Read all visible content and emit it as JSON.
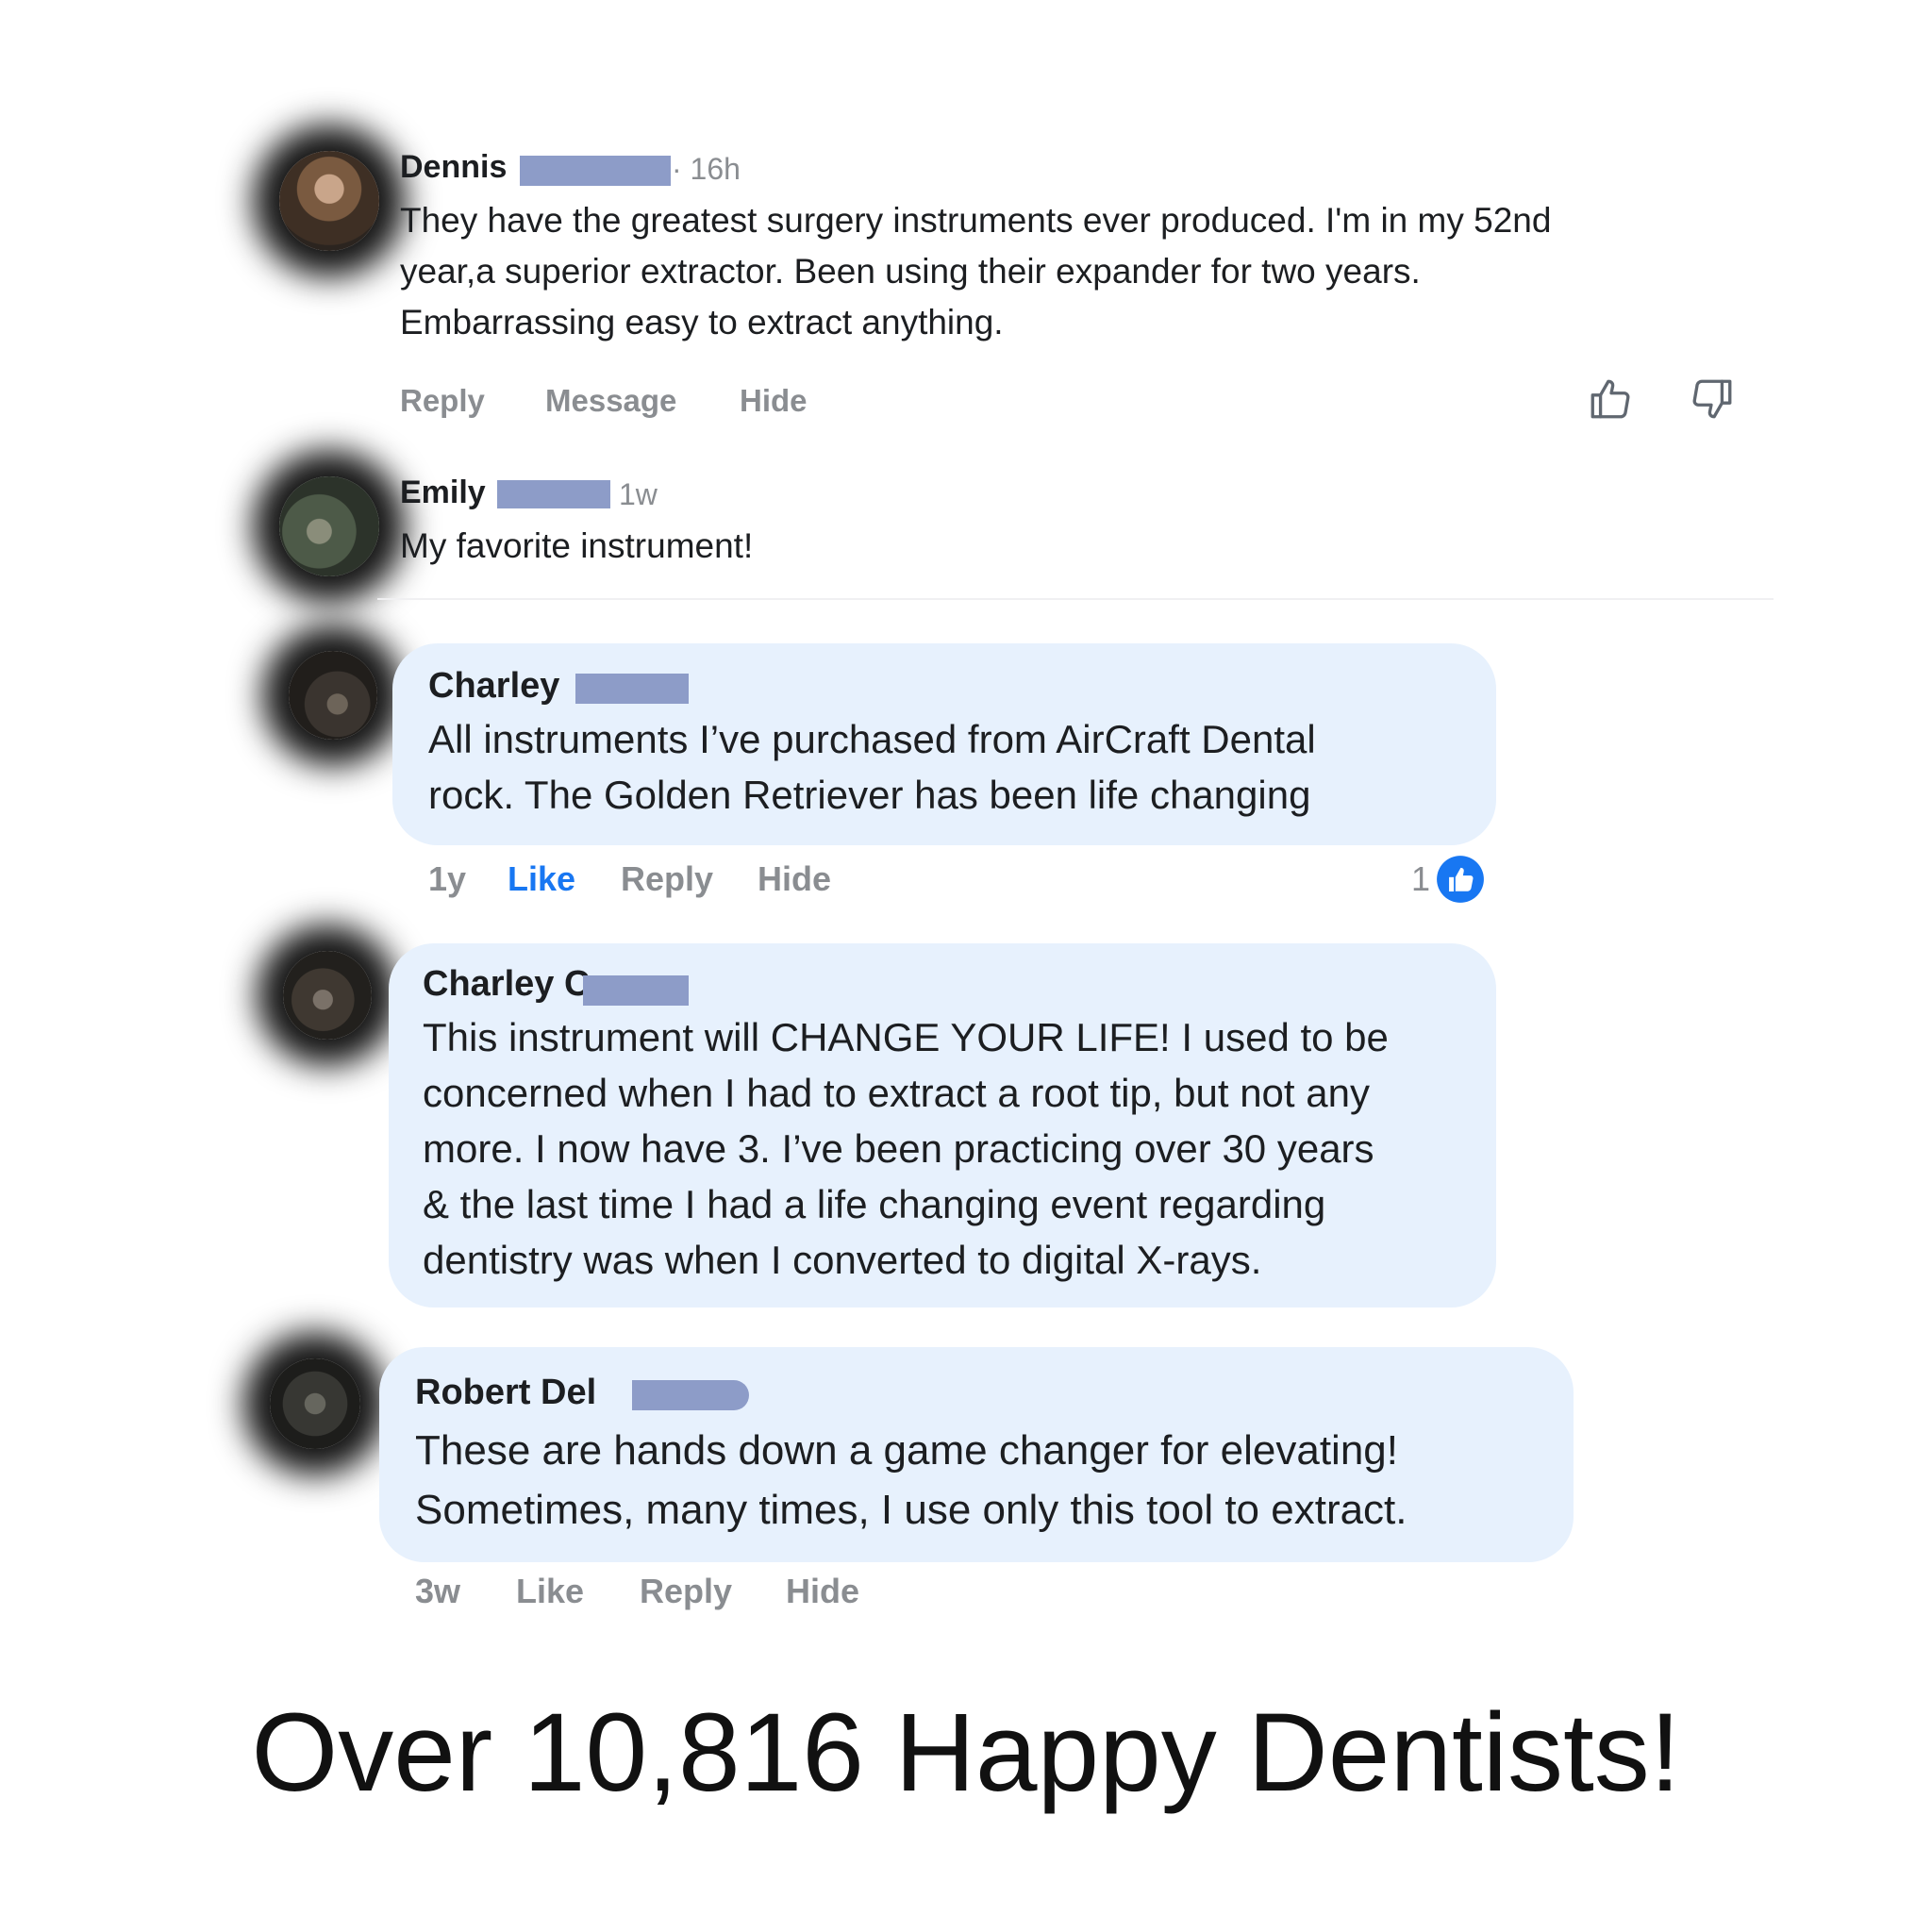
{
  "comments": [
    {
      "name": "Dennis",
      "time": "· 16h",
      "lines": [
        "They have the greatest surgery instruments ever produced.  I'm in my 52nd",
        "year,a superior extractor. Been using their expander for two years.",
        "Embarrassing easy to extract anything."
      ],
      "actions": [
        "Reply",
        "Message",
        "Hide"
      ],
      "icons": [
        "thumbs-up-outline-icon",
        "thumbs-down-outline-icon"
      ]
    },
    {
      "name": "Emily",
      "time": "1w",
      "lines": [
        "My favorite instrument!"
      ]
    },
    {
      "name": "Charley",
      "lines": [
        "All instruments I’ve purchased from AirCraft Dental",
        "rock. The Golden Retriever has been life changing"
      ],
      "time": "1y",
      "actions": [
        "Like",
        "Reply",
        "Hide"
      ],
      "reaction_count": "1",
      "reaction_color": "#1877f2"
    },
    {
      "name": "Charley C",
      "lines": [
        "This instrument will CHANGE YOUR LIFE! I used to be",
        "concerned when I had to extract a root tip, but not any",
        "more. I now have 3. I’ve been practicing over 30 years",
        "& the last time I had a life changing event regarding",
        "dentistry was when I converted to digital X-rays."
      ]
    },
    {
      "name": "Robert Del",
      "lines": [
        "These are hands down a game changer for elevating!",
        "Sometimes, many times, I use only this tool to extract."
      ],
      "time": "3w",
      "actions": [
        "Like",
        "Reply",
        "Hide"
      ]
    }
  ],
  "footer": "Over 10,816 Happy Dentists!",
  "colors": {
    "bubble": "#e7f1fd",
    "like_blue": "#1877f2",
    "redaction": "#8d9cc8",
    "meta_gray": "#8a8d91"
  }
}
